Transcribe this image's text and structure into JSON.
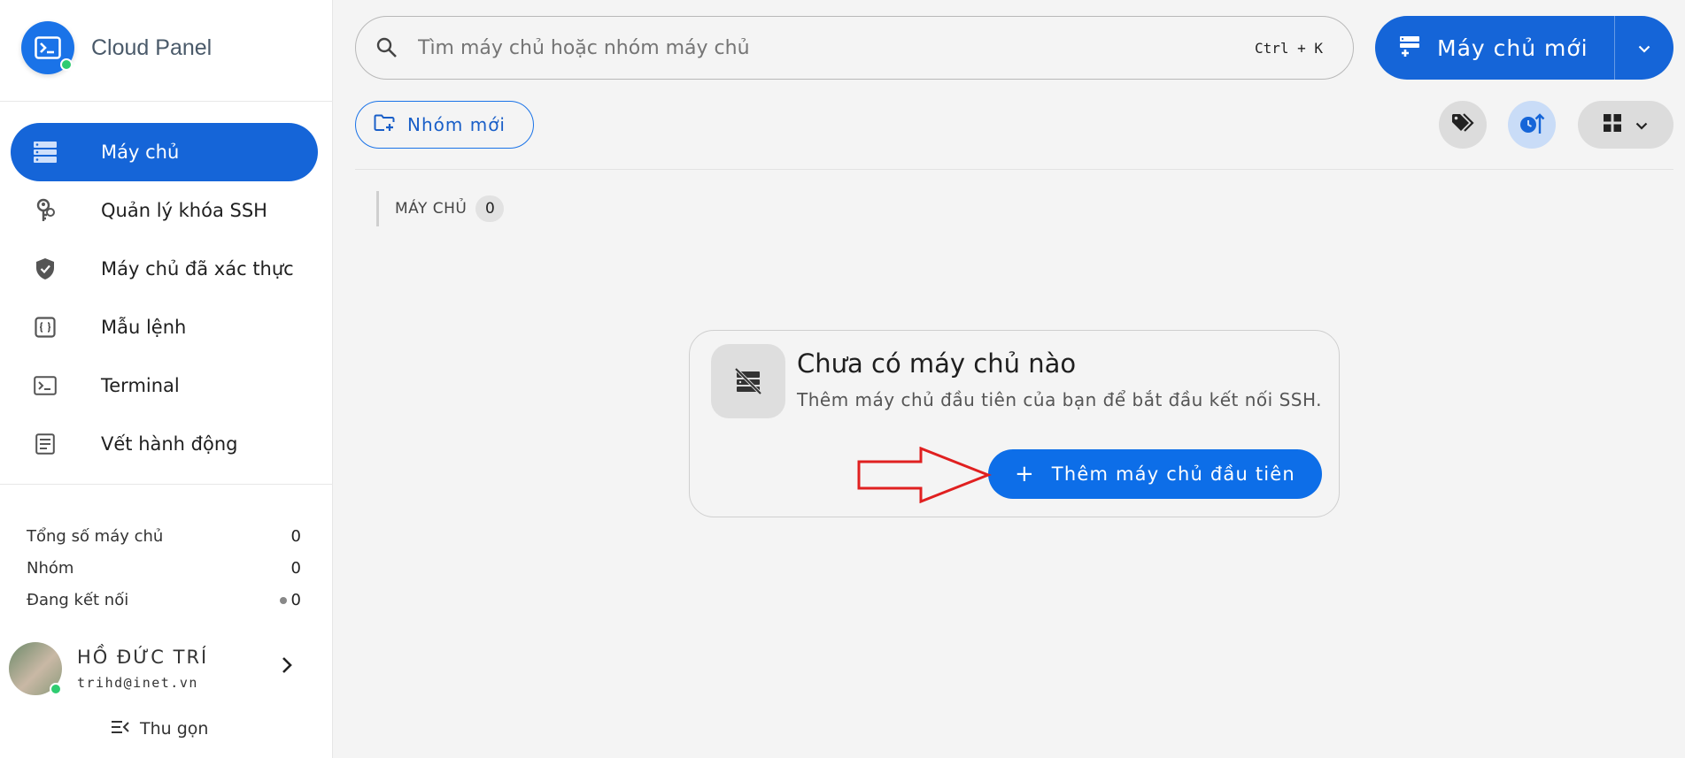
{
  "app": {
    "name": "Cloud Panel"
  },
  "sidebar": {
    "items": [
      {
        "label": "Máy chủ",
        "icon": "server-icon",
        "active": true
      },
      {
        "label": "Quản lý khóa SSH",
        "icon": "key-icon"
      },
      {
        "label": "Máy chủ đã xác thực",
        "icon": "shield-check-icon"
      },
      {
        "label": "Mẫu lệnh",
        "icon": "snippet-icon"
      },
      {
        "label": "Terminal",
        "icon": "terminal-icon"
      },
      {
        "label": "Vết hành động",
        "icon": "log-icon"
      }
    ],
    "stats": [
      {
        "label": "Tổng số máy chủ",
        "value": "0"
      },
      {
        "label": "Nhóm",
        "value": "0"
      },
      {
        "label": "Đang kết nối",
        "value": "0"
      }
    ],
    "user": {
      "name": "HỒ ĐỨC TRÍ",
      "email": "trihd@inet.vn"
    },
    "collapse_label": "Thu gọn"
  },
  "search": {
    "placeholder": "Tìm máy chủ hoặc nhóm máy chủ",
    "shortcut": "Ctrl + K"
  },
  "toolbar": {
    "new_server_label": "Máy chủ mới",
    "new_group_label": "Nhóm mới"
  },
  "section": {
    "title": "MÁY CHỦ",
    "count": "0"
  },
  "empty_state": {
    "title": "Chưa có máy chủ nào",
    "description": "Thêm máy chủ đầu tiên của bạn để bắt đầu kết nối SSH.",
    "button_label": "Thêm máy chủ đầu tiên",
    "button_plus": "+"
  },
  "colors": {
    "primary": "#1565d8",
    "online": "#2ecc71",
    "annotation_arrow": "#e02020"
  }
}
